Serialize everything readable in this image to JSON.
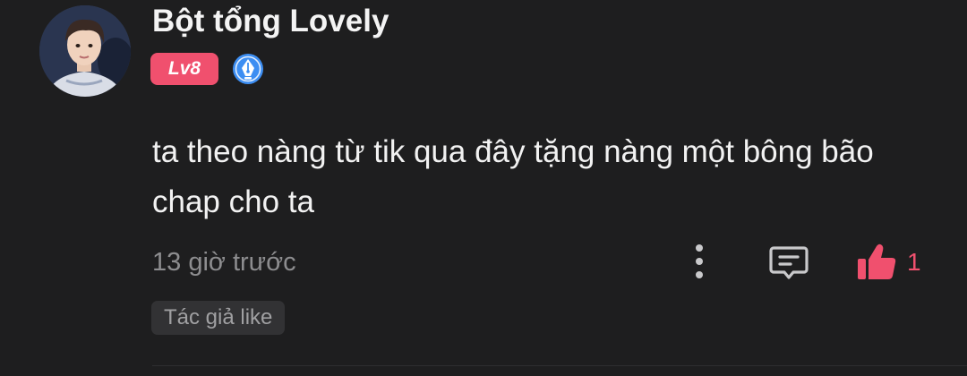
{
  "comment": {
    "username": "Bột tổng Lovely",
    "level_badge": "Lv8",
    "author_badge_icon": "fountain-pen-icon",
    "text": "ta theo nàng từ tik qua đây tặng nàng một bông bão chap cho ta",
    "timestamp": "13 giờ trước",
    "actions": {
      "more_icon": "more-vertical-icon",
      "reply_icon": "comment-reply-icon",
      "like_icon": "thumbs-up-icon",
      "like_count": "1"
    },
    "author_liked_tag": "Tác giả like"
  },
  "colors": {
    "background": "#1e1e1f",
    "accent": "#f0506e",
    "badge_blue": "#3d8ef2",
    "muted_text": "#8d8d8f"
  }
}
